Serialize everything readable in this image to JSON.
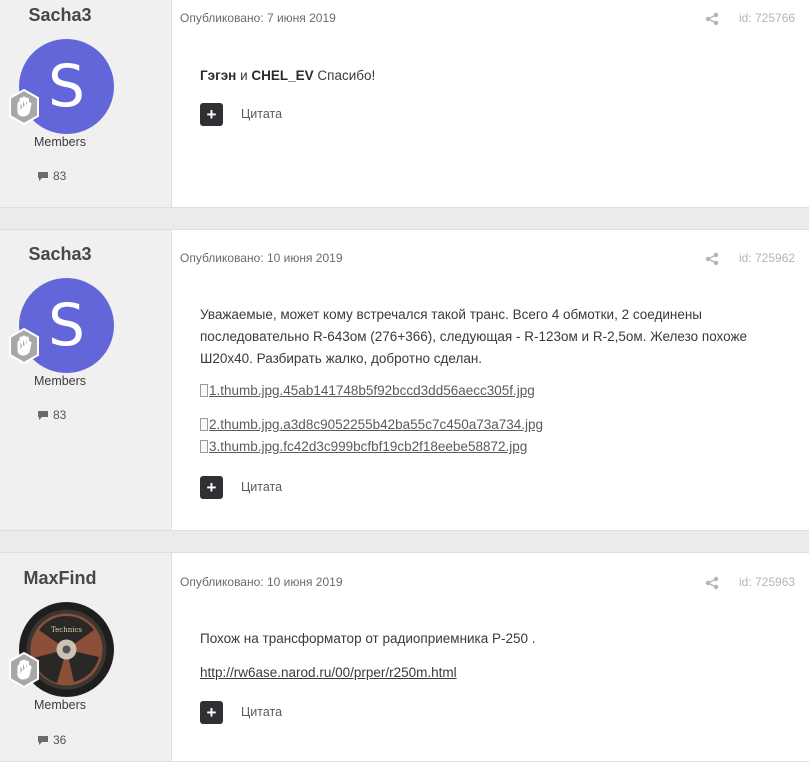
{
  "posts": [
    {
      "author": "Sacha3",
      "avatar_letter": "S",
      "group": "Members",
      "post_count": "83",
      "meta": "Опубликовано: 7 июня 2019",
      "id_label": "id: 725766",
      "content_parts": [
        "Гэгэн",
        " и ",
        "CHEL_EV",
        " Спасибо!"
      ],
      "quote_label": "Цитата"
    },
    {
      "author": "Sacha3",
      "avatar_letter": "S",
      "group": "Members",
      "post_count": "83",
      "meta": "Опубликовано: 10 июня 2019",
      "id_label": "id: 725962",
      "content": "Уважаемые, может кому встречался такой транс. Всего 4 обмотки, 2 соединены последовательно R-643ом (276+366), следующая - R-123ом и R-2,5ом. Железо похоже Ш20х40. Разбирать жалко, добротно сделан.",
      "images": [
        "1.thumb.jpg.45ab141748b5f92bccd3dd56aecc305f.jpg",
        "2.thumb.jpg.a3d8c9052255b42ba55c7c450a73a734.jpg",
        "3.thumb.jpg.fc42d3c999bcfbf19cb2f18eebe58872.jpg"
      ],
      "quote_label": "Цитата"
    },
    {
      "author": "MaxFind",
      "avatar_text": "Technics",
      "group": "Members",
      "post_count": "36",
      "meta": "Опубликовано: 10 июня 2019",
      "id_label": "id: 725963",
      "content": "Похож на трансформатор от радиоприемника Р-250 .",
      "link": "http://rw6ase.narod.ru/00/prper/r250m.html",
      "quote_label": "Цитата"
    }
  ],
  "colors": {
    "avatar_bg": "#6366d8",
    "quote_button": "#2f3033",
    "sidebar_bg": "#f0f0f0"
  }
}
